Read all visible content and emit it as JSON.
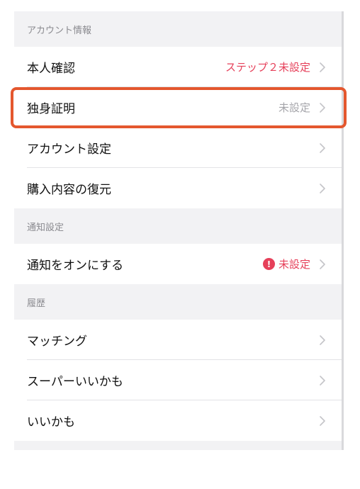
{
  "sections": [
    {
      "header": "アカウント情報",
      "rows": [
        {
          "label": "本人確認",
          "status": "ステップ２未設定",
          "status_color": "red"
        },
        {
          "label": "独身証明",
          "status": "未設定",
          "status_color": "gray"
        },
        {
          "label": "アカウント設定",
          "status": "",
          "status_color": "gray"
        },
        {
          "label": "購入内容の復元",
          "status": "",
          "status_color": "gray"
        }
      ]
    },
    {
      "header": "通知設定",
      "rows": [
        {
          "label": "通知をオンにする",
          "status": "未設定",
          "status_color": "red",
          "alert_icon": "!"
        }
      ]
    },
    {
      "header": "履歴",
      "rows": [
        {
          "label": "マッチング",
          "status": "",
          "status_color": "gray"
        },
        {
          "label": "スーパーいいかも",
          "status": "",
          "status_color": "gray"
        },
        {
          "label": "いいかも",
          "status": "",
          "status_color": "gray"
        }
      ]
    }
  ],
  "colors": {
    "status_red": "#e6405a",
    "status_gray": "#a5a5aa",
    "highlight": "#e4572e",
    "background": "#f2f2f4"
  },
  "icons": {
    "row_chevron": "chevron-right-icon",
    "alert": "exclamation-circle-icon"
  }
}
